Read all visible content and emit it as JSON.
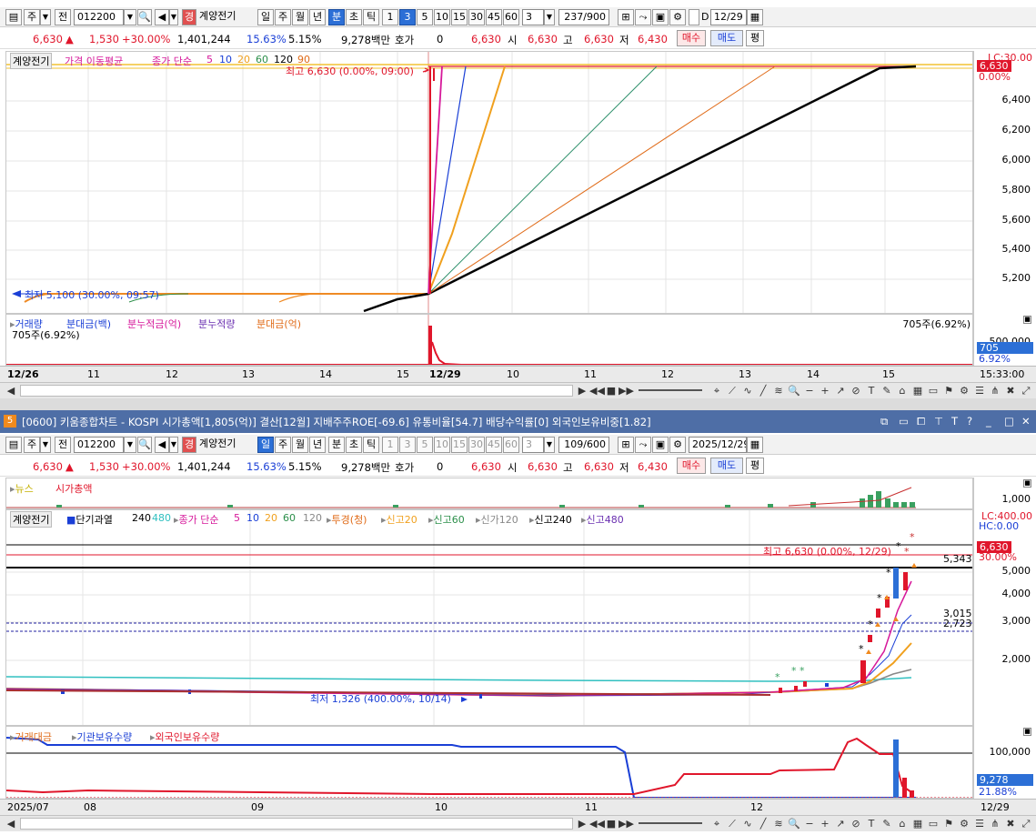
{
  "toolbar_top": {
    "period": "주",
    "prev": "전",
    "code": "012200",
    "name": "계양전기",
    "day": "일",
    "week": "주",
    "month": "월",
    "year": "년",
    "minute": "분",
    "second": "초",
    "tick": "틱",
    "intervals": [
      "1",
      "3",
      "5",
      "10",
      "15",
      "30",
      "45",
      "60"
    ],
    "interval_sel": "3",
    "count": "237/900",
    "date": "12/29",
    "d_label": "D"
  },
  "toolbar_bottom": {
    "period": "주",
    "prev": "전",
    "code": "012200",
    "name": "계양전기",
    "day": "일",
    "week": "주",
    "month": "월",
    "year": "년",
    "minute": "분",
    "second": "초",
    "tick": "틱",
    "intervals": [
      "1",
      "3",
      "5",
      "10",
      "15",
      "30",
      "45",
      "60"
    ],
    "interval_sel": "3",
    "count": "109/600",
    "date": "2025/12/29"
  },
  "quote": {
    "price": "6,630",
    "arrow": "▲",
    "change": "1,530",
    "pct": "+30.00%",
    "volume": "1,401,244",
    "turnover": "15.63%",
    "ratio": "5.15%",
    "amount": "9,278백만",
    "hoga_label": "호가",
    "hoga": "0",
    "ask": "6,630",
    "open_label": "시",
    "open": "6,630",
    "high_label": "고",
    "high": "6,630",
    "low_label": "저",
    "low": "6,430",
    "buy": "매수",
    "sell": "매도",
    "avg": "평"
  },
  "top_chart": {
    "legend": {
      "name": "계양전기",
      "ma_title": "가격 이동평균",
      "ma_type": "종가 단순",
      "periods": [
        "5",
        "10",
        "20",
        "60",
        "120",
        "90"
      ]
    },
    "lc_label": "LC:30.00",
    "price_tag": "6,630",
    "pct_tag": "0.00%",
    "y_ticks": [
      "6,400",
      "6,200",
      "6,000",
      "5,800",
      "5,600",
      "5,400",
      "5,200"
    ],
    "high_note": "최고 6,630 (0.00%, 09:00)",
    "low_note": "최저 5,100 (30.00%, 09:57)",
    "vol_legend": [
      "거래량",
      "분대금(백)",
      "분누적금(억)",
      "분누적량",
      "분대금(억)"
    ],
    "vol_note_right": "705주(6.92%)",
    "vol_note_left": "705주(6.92%)",
    "vol_ticks": [
      "500,000"
    ],
    "vol_tag": "705",
    "vol_pct": "6.92%",
    "x_labels": [
      "12/26",
      "11",
      "12",
      "13",
      "14",
      "15",
      "12/29",
      "10",
      "11",
      "12",
      "13",
      "14",
      "15"
    ],
    "time": "15:33:00"
  },
  "window": {
    "number": "5",
    "title": "[0600] 키움종합차트 - KOSPI 시가총액[1,805(억)] 결산[12월] 지배주주ROE[-69.6] 유통비율[54.7] 배당수익률[0] 외국인보유비중[1.82]"
  },
  "bottom_chart": {
    "news_legend": [
      "뉴스",
      "시가총액"
    ],
    "news_tick": "1,000",
    "legend": {
      "name": "계양전기",
      "short": "단기과열",
      "n240": "240",
      "n480": "480",
      "ma_type": "종가 단순",
      "periods": [
        "5",
        "10",
        "20",
        "60",
        "120"
      ],
      "tugyeong": "투경(청)",
      "new20": "신고20",
      "new60": "신고60",
      "new120": "신가120",
      "new240": "신고240",
      "new480": "신고480"
    },
    "lc_label": "LC:400.00",
    "hc_label": "HC:0.00",
    "price_tag": "6,630",
    "pct_tag": "30.00%",
    "y_ticks": [
      "5,000",
      "4,000",
      "3,000",
      "2,000"
    ],
    "line_labels": [
      "5,343",
      "3,015",
      "2,723"
    ],
    "high_note": "최고 6,630 (0.00%, 12/29)",
    "low_note": "최저 1,326 (400.00%, 10/14)",
    "vol_legend": [
      "거래대금",
      "기관보유수량",
      "외국인보유수량"
    ],
    "vol_tick": "100,000",
    "vol_tag": "9,278",
    "vol_pct": "21.88%",
    "x_labels": [
      "2025/07",
      "08",
      "09",
      "10",
      "11",
      "12",
      "12/29"
    ]
  },
  "chart_data": [
    {
      "type": "line",
      "title": "",
      "x_range": [
        "12/26 09:00",
        "12/29 15:30"
      ],
      "ylim": [
        5100,
        6630
      ],
      "y_ticks": [
        6400,
        6200,
        6000,
        5800,
        5600,
        5400,
        5200
      ],
      "series": [
        {
          "name": "5",
          "values": [
            5100,
            6630
          ]
        },
        {
          "name": "10",
          "values": [
            5100,
            6630
          ]
        },
        {
          "name": "20",
          "values": [
            5100,
            6630
          ]
        },
        {
          "name": "60",
          "values": [
            5100,
            6630
          ]
        },
        {
          "name": "120",
          "values": [
            5100,
            6630
          ]
        },
        {
          "name": "90",
          "values": [
            5100,
            6630
          ]
        }
      ]
    },
    {
      "type": "line",
      "title": "",
      "x_range": [
        "2025/07",
        "2025/12/29"
      ],
      "ylim": [
        1326,
        6630
      ],
      "y_ticks": [
        5000,
        4000,
        3000,
        2000
      ],
      "hlines": [
        5343,
        3015,
        2723
      ],
      "series": [
        {
          "name": "5",
          "values": [
            1400,
            1420,
            1380,
            1350,
            1330,
            1400,
            1500,
            4500
          ]
        }
      ]
    }
  ]
}
